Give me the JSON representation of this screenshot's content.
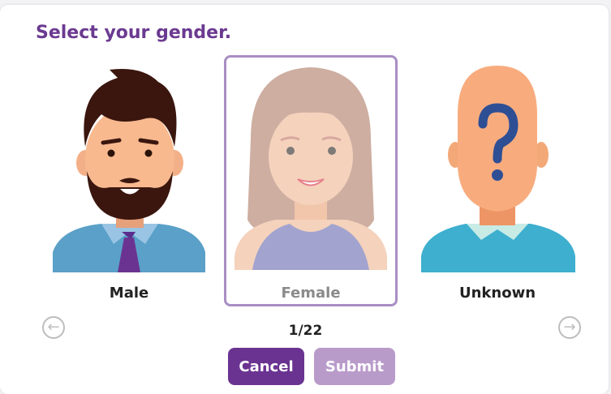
{
  "prompt": "Select your gender.",
  "options": [
    {
      "label": "Male",
      "selected": false,
      "avatar": "male-avatar"
    },
    {
      "label": "Female",
      "selected": true,
      "avatar": "female-avatar"
    },
    {
      "label": "Unknown",
      "selected": false,
      "avatar": "unknown-avatar"
    }
  ],
  "pager": {
    "text": "1/22",
    "prev_icon": "arrow-left-circle-icon",
    "next_icon": "arrow-right-circle-icon"
  },
  "buttons": {
    "cancel": "Cancel",
    "submit": "Submit"
  },
  "colors": {
    "title": "#6b3a91",
    "cancel_bg": "#6b3391",
    "submit_bg": "#b99bca",
    "selected_border": "#a98ec4"
  }
}
